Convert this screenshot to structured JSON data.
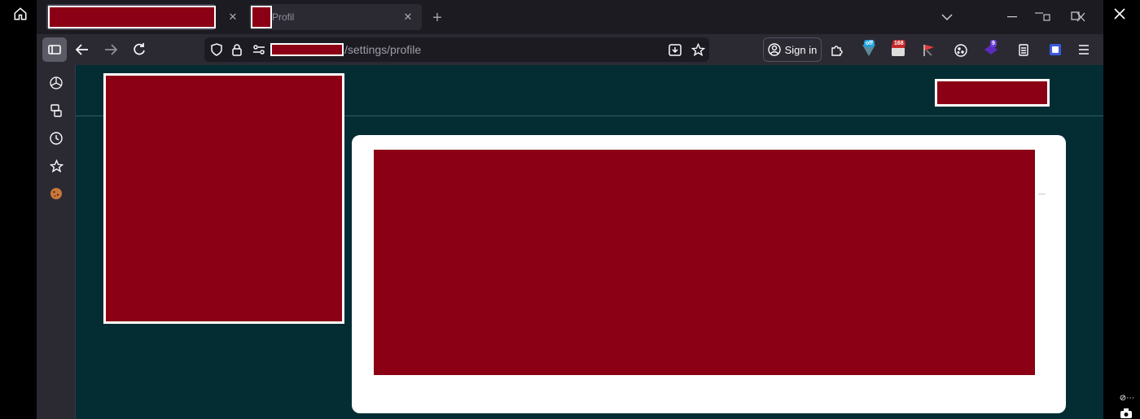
{
  "tabs": [
    {
      "label": ""
    },
    {
      "label": "Profil"
    }
  ],
  "toolbar": {
    "url_path": "/settings/profile",
    "signin_label": "Sign in"
  },
  "extensions": [
    {
      "icon": "tag-off-extension-icon",
      "badge": "off"
    },
    {
      "icon": "calendar-extension-icon",
      "badge": "168"
    },
    {
      "icon": "red-flag-extension-icon",
      "badge": ""
    },
    {
      "icon": "cookie-extension-icon",
      "badge": ""
    },
    {
      "icon": "purple-extension-icon",
      "badge": "9"
    }
  ],
  "colors": {
    "redaction": "#8b0015",
    "page_background": "#032d33",
    "browser_chrome": "#2b2a33",
    "card": "#ffffff"
  }
}
